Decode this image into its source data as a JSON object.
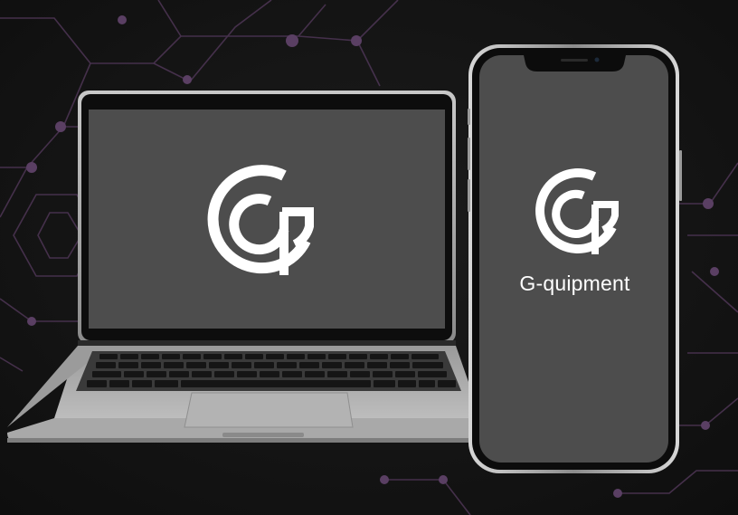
{
  "brand": {
    "name": "G-quipment",
    "logo_icon": "gq-monogram-icon",
    "logo_color": "#ffffff"
  },
  "colors": {
    "background": "#151515",
    "circuit": "#5a3f63",
    "screen": "#4d4d4d",
    "bezel": "#111111",
    "laptop_body": "#a6a6a6"
  }
}
